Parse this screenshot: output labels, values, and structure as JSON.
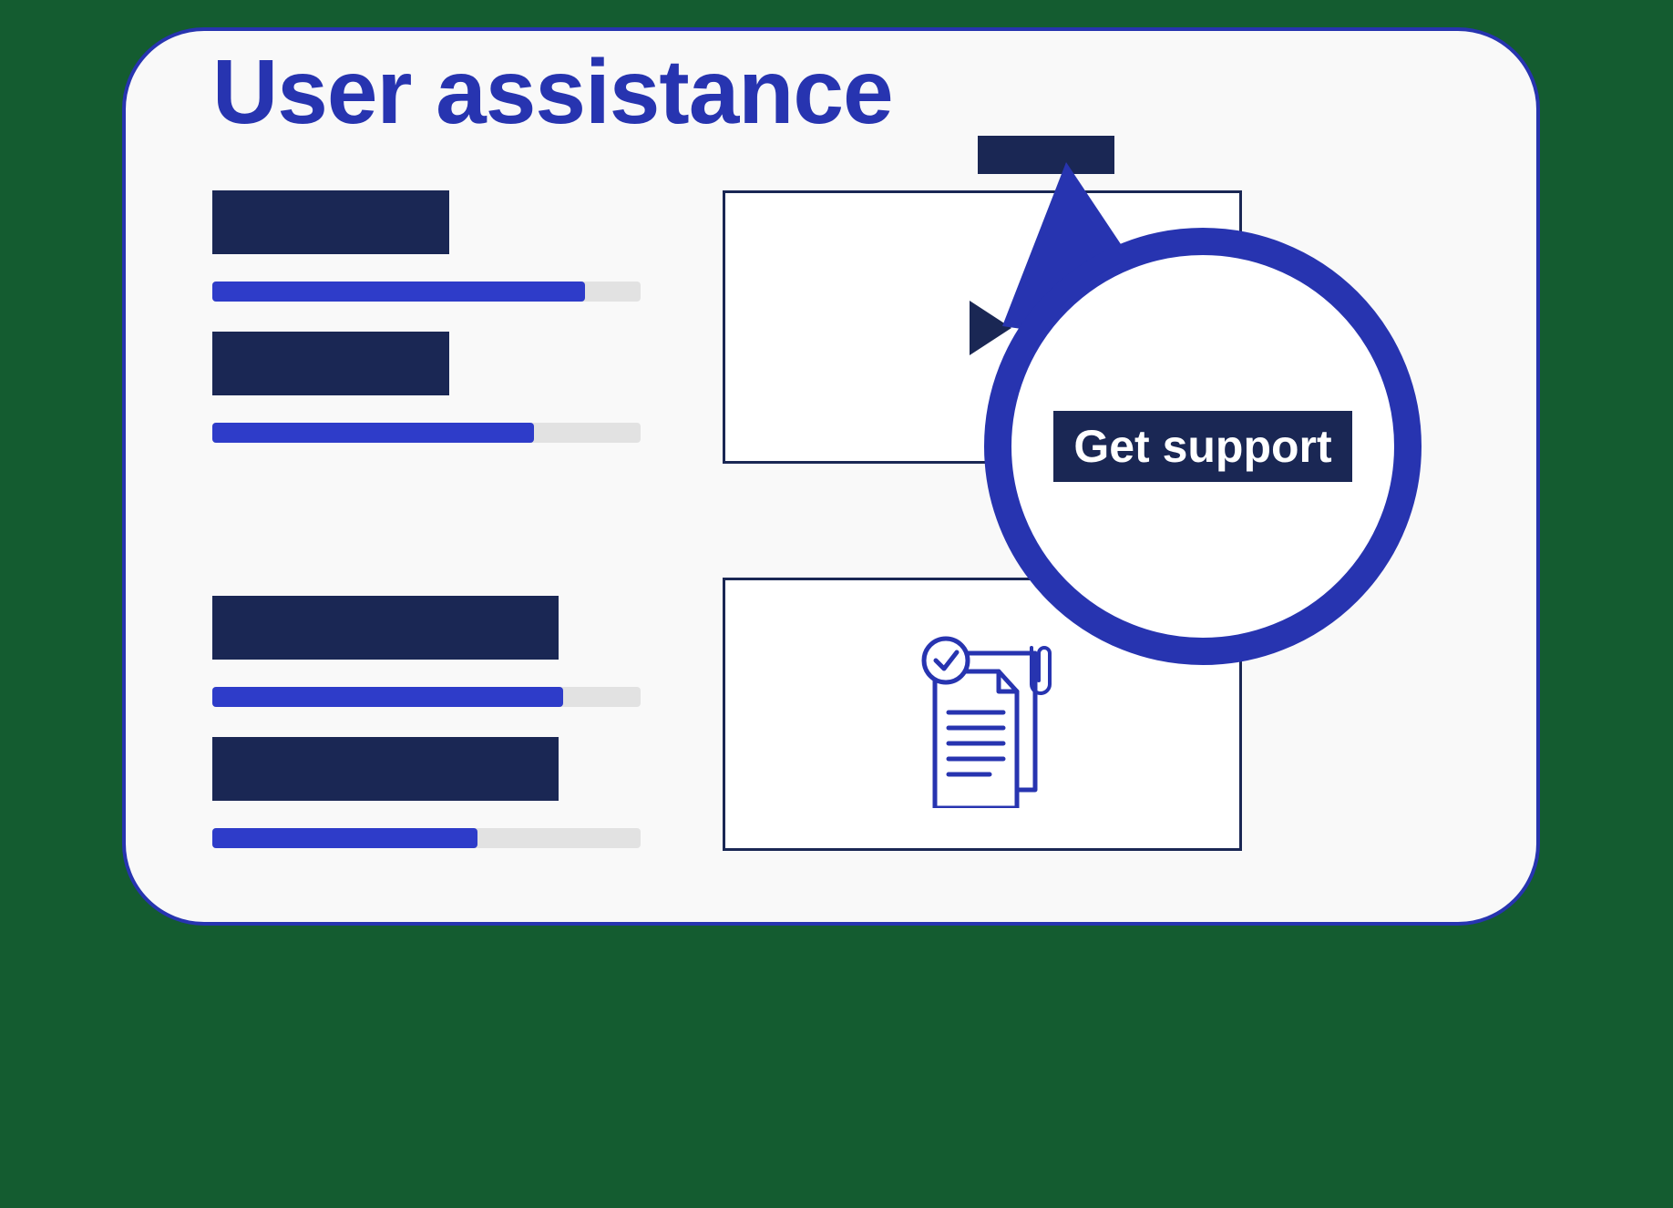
{
  "panel": {
    "title": "User assistance"
  },
  "left_column": {
    "items": [
      {
        "block_width": 260,
        "bar_fill_percent": 87
      },
      {
        "block_width": 260,
        "bar_fill_percent": 75
      },
      {
        "block_width": 380,
        "bar_fill_percent": 82
      },
      {
        "block_width": 380,
        "bar_fill_percent": 62
      }
    ]
  },
  "right_column": {
    "top_tile": "video",
    "bottom_tile": "documents"
  },
  "callout": {
    "button_label": "Get support"
  },
  "colors": {
    "navy": "#1a2754",
    "blue": "#2734b0",
    "bright_blue": "#2e3cc9",
    "light_gray": "#e2e2e2",
    "off_white": "#f9f9f9",
    "green": "#145c30"
  }
}
